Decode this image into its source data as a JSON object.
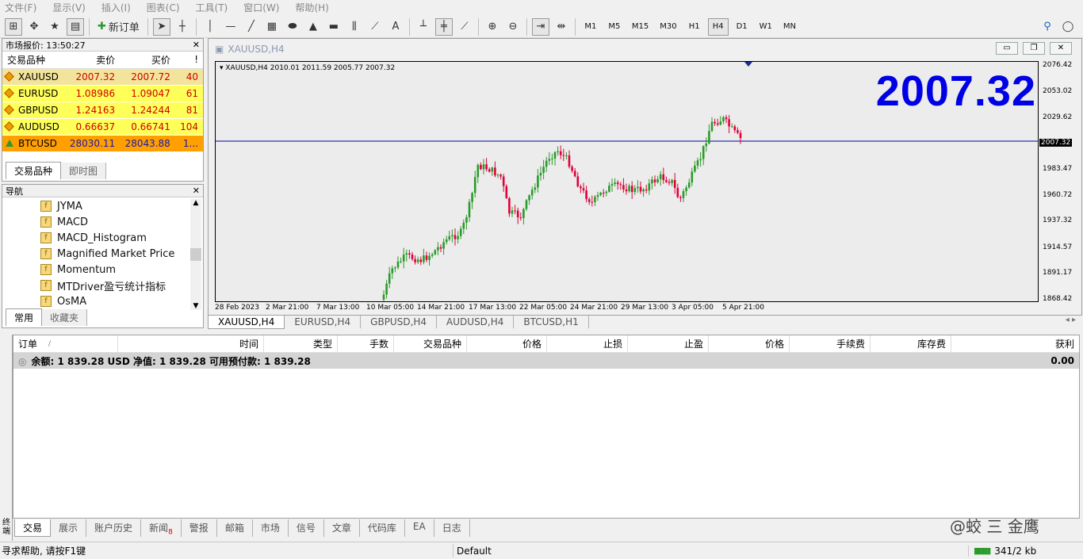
{
  "menu": [
    "文件(F)",
    "显示(V)",
    "插入(I)",
    "图表(C)",
    "工具(T)",
    "窗口(W)",
    "帮助(H)"
  ],
  "toolbar": {
    "new_order": "新订单",
    "timeframes": [
      "M1",
      "M5",
      "M15",
      "M30",
      "H1",
      "H4",
      "D1",
      "W1",
      "MN"
    ],
    "active_tf": "H4"
  },
  "market_watch": {
    "title": "市场报价: 13:50:27",
    "headers": [
      "交易品种",
      "卖价",
      "买价",
      "!"
    ],
    "rows": [
      {
        "symbol": "XAUUSD",
        "bid": "2007.32",
        "ask": "2007.72",
        "spread": "40"
      },
      {
        "symbol": "EURUSD",
        "bid": "1.08986",
        "ask": "1.09047",
        "spread": "61"
      },
      {
        "symbol": "GBPUSD",
        "bid": "1.24163",
        "ask": "1.24244",
        "spread": "81"
      },
      {
        "symbol": "AUDUSD",
        "bid": "0.66637",
        "ask": "0.66741",
        "spread": "104"
      },
      {
        "symbol": "BTCUSD",
        "bid": "28030.11",
        "ask": "28043.88",
        "spread": "1..."
      }
    ],
    "tabs": [
      "交易品种",
      "即时图"
    ]
  },
  "navigator": {
    "title": "导航",
    "items": [
      "JYMA",
      "MACD",
      "MACD_Histogram",
      "Magnified Market Price",
      "Momentum",
      "MTDriver盈亏统计指标",
      "OsMA"
    ],
    "tabs": [
      "常用",
      "收藏夹"
    ]
  },
  "chart": {
    "window_title": "XAUUSD,H4",
    "info": "XAUUSD,H4  2010.01 2011.59 2005.77 2007.32",
    "big_price": "2007.32",
    "current_price_label": "2007.32",
    "y_ticks": [
      "2076.42",
      "2053.02",
      "2029.62",
      "2007.32",
      "1983.47",
      "1960.72",
      "1937.32",
      "1914.57",
      "1891.17",
      "1868.42"
    ],
    "x_ticks": [
      "28 Feb 2023",
      "2 Mar 21:00",
      "7 Mar 13:00",
      "10 Mar 05:00",
      "14 Mar 21:00",
      "17 Mar 13:00",
      "22 Mar 05:00",
      "24 Mar 21:00",
      "29 Mar 13:00",
      "3 Apr 05:00",
      "5 Apr 21:00"
    ],
    "colors": {
      "up": "#2a9a2a",
      "down": "#e0003a",
      "price_line": "#0000a0",
      "big_price": "#0000e6"
    }
  },
  "chart_tabs": [
    "XAUUSD,H4",
    "EURUSD,H4",
    "GBPUSD,H4",
    "AUDUSD,H4",
    "BTCUSD,H1"
  ],
  "terminal": {
    "headers": [
      "订单",
      "时间",
      "类型",
      "手数",
      "交易品种",
      "价格",
      "止损",
      "止盈",
      "价格",
      "手续费",
      "库存费",
      "获利"
    ],
    "balance": "余额: 1 839.28 USD  净值: 1 839.28  可用预付款: 1 839.28",
    "profit": "0.00",
    "side_label": "终端",
    "tabs": [
      "交易",
      "展示",
      "账户历史",
      "新闻",
      "警报",
      "邮箱",
      "市场",
      "信号",
      "文章",
      "代码库",
      "EA",
      "日志"
    ],
    "news_badge": "8"
  },
  "watermark": "@蛟 三 金鹰",
  "status": {
    "help": "寻求帮助, 请按F1键",
    "profile": "Default",
    "traffic": "341/2 kb"
  }
}
